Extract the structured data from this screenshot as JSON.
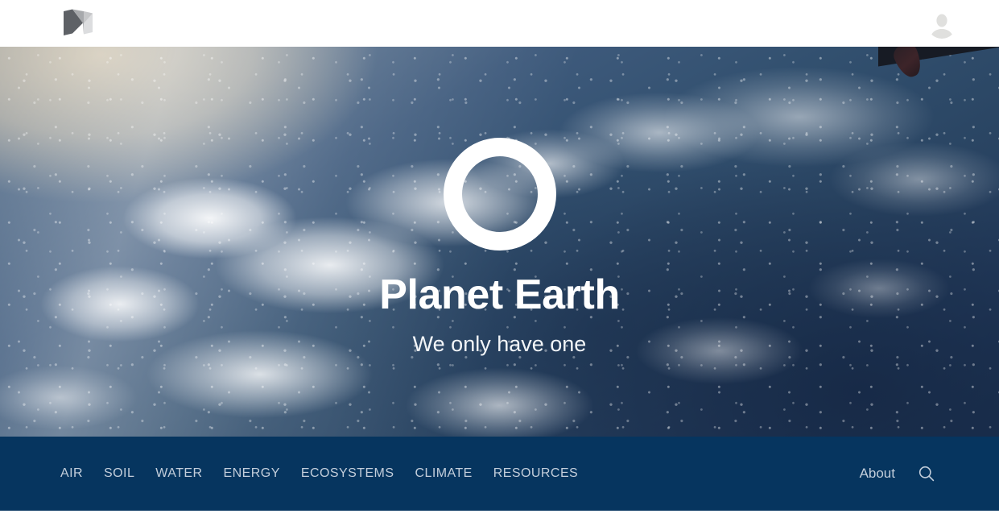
{
  "header": {
    "logo_icon": "medium-folded-m-logo-icon",
    "avatar_icon": "user-avatar-placeholder-icon"
  },
  "hero": {
    "ring_icon": "circle-outline-logo-icon",
    "title": "Planet Earth",
    "subtitle": "We only have one",
    "background_description": "earth-from-space-photo"
  },
  "nav": {
    "items": [
      {
        "label": "AIR"
      },
      {
        "label": "SOIL"
      },
      {
        "label": "WATER"
      },
      {
        "label": "ENERGY"
      },
      {
        "label": "ECOSYSTEMS"
      },
      {
        "label": "CLIMATE"
      },
      {
        "label": "RESOURCES"
      }
    ],
    "about_label": "About",
    "search_icon": "search-icon"
  },
  "colors": {
    "nav_background": "#06355f",
    "nav_text": "#c3cedb",
    "hero_text": "#ffffff",
    "header_background": "#ffffff"
  }
}
